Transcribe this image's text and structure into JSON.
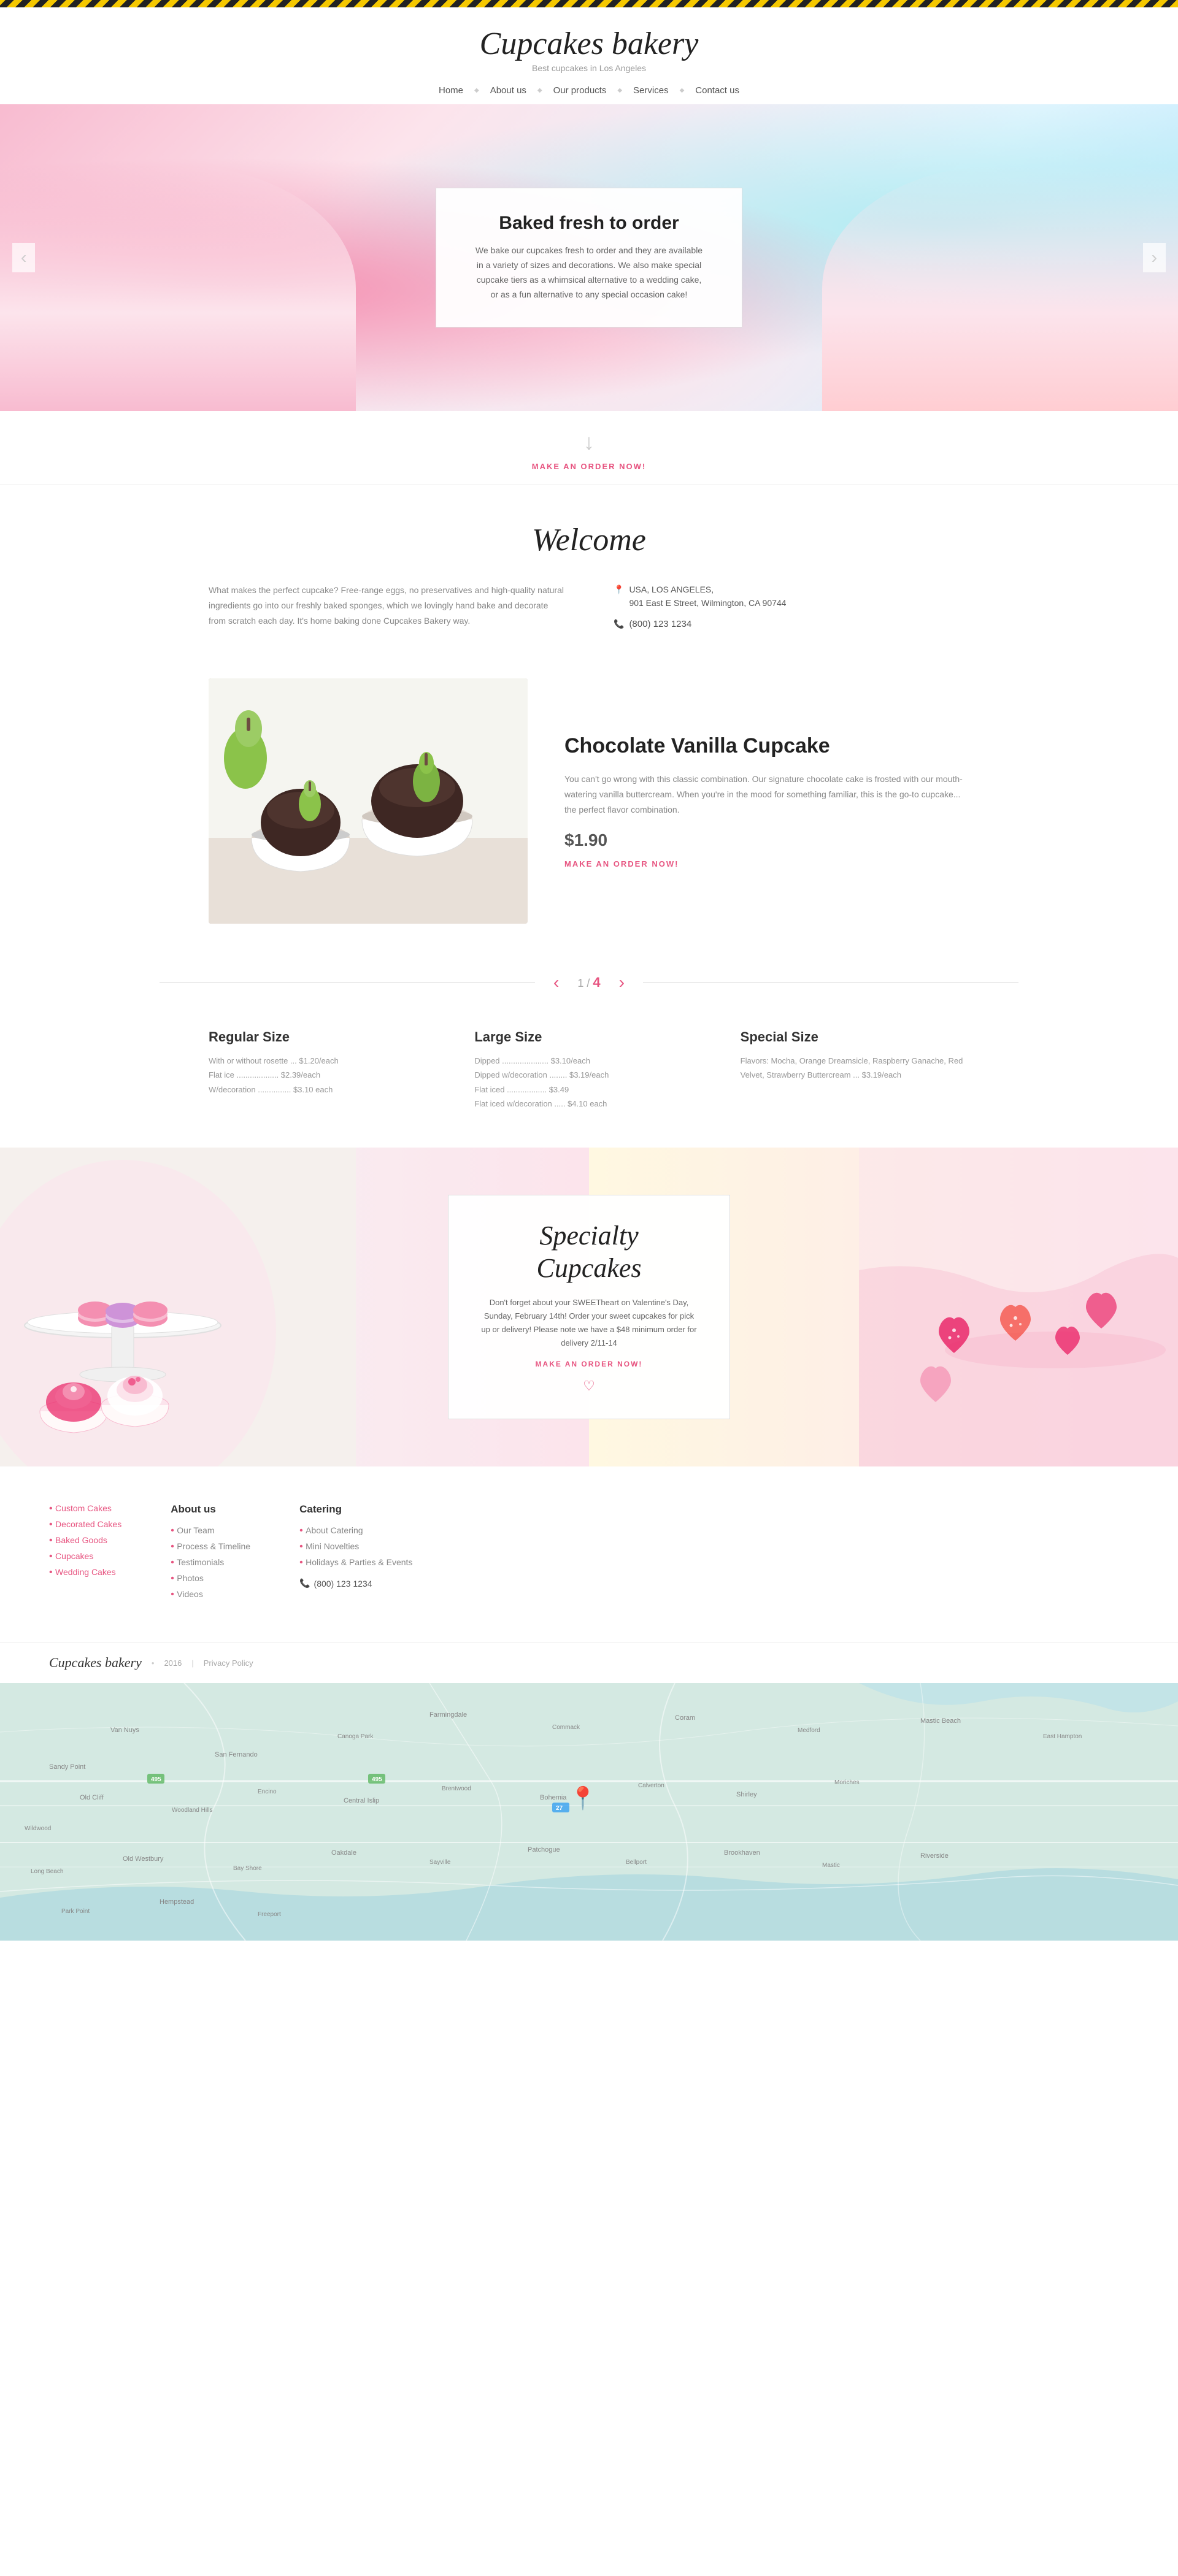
{
  "site": {
    "title": "Cupcakes bakery",
    "subtitle": "Best cupcakes in Los Angeles"
  },
  "nav": {
    "items": [
      {
        "label": "Home",
        "href": "#"
      },
      {
        "label": "About us",
        "href": "#"
      },
      {
        "label": "Our products",
        "href": "#"
      },
      {
        "label": "Services",
        "href": "#"
      },
      {
        "label": "Contact us",
        "href": "#"
      }
    ]
  },
  "hero": {
    "title": "Baked fresh to order",
    "description": "We bake our cupcakes fresh to order and they are available in a variety of sizes and decorations. We also make special cupcake tiers as a whimsical alternative to a wedding cake, or as a fun alternative to any special occasion cake!",
    "arrow_left": "‹",
    "arrow_right": "›"
  },
  "cta": {
    "arrow": "↓",
    "label": "MAKE AN ORDER NOW!"
  },
  "welcome": {
    "title": "Welcome",
    "text": "What makes the perfect cupcake? Free-range eggs, no preservatives and high-quality natural ingredients go into our freshly baked sponges, which we lovingly hand bake and decorate from scratch each day. It's home baking done Cupcakes Bakery way.",
    "address_line1": "USA, LOS ANGELES,",
    "address_line2": "901 East E Street, Wilmington, CA 90744",
    "phone": "(800) 123 1234"
  },
  "product": {
    "name": "Chocolate Vanilla Cupcake",
    "description": "You can't go wrong with this classic combination. Our signature chocolate cake is frosted with our mouth-watering vanilla buttercream. When you're in the mood for something familiar, this is the go-to cupcake... the perfect flavor combination.",
    "price": "$1.90",
    "order_label": "MAKE AN ORDER NOW!",
    "page_current": "1",
    "page_separator": "/",
    "page_total": "4"
  },
  "sizes": [
    {
      "title": "Regular Size",
      "details": "With or without rosette ... $1.20/each\nFlat ice ................... $2.39/each\nW/decoration ............... $3.10 each"
    },
    {
      "title": "Large Size",
      "details": "Dipped ..................... $3.10/each\nDipped w/decoration ........ $3.19/each\nFlat iced .................. $3.49\nFlat iced w/decoration ..... $4.10 each"
    },
    {
      "title": "Special Size",
      "details": "Flavors: Mocha, Orange Dreamsicle, Raspberry Ganache, Red Velvet, Strawberry Buttercream ... $3.19/each"
    }
  ],
  "specialty": {
    "title": "Specialty\nCupcakes",
    "description": "Don't forget about your SWEETheart on Valentine's Day, Sunday, February 14th! Order your sweet cupcakes for pick up or delivery! Please note we have a $48 minimum order for delivery 2/11-14",
    "order_label": "MAKE AN ORDER NOW!",
    "heart": "♡"
  },
  "footer": {
    "col1_title": "",
    "col1_links": [
      {
        "label": "Custom Cakes",
        "href": "#"
      },
      {
        "label": "Decorated Cakes",
        "href": "#"
      },
      {
        "label": "Baked Goods",
        "href": "#"
      },
      {
        "label": "Cupcakes",
        "href": "#"
      },
      {
        "label": "Wedding Cakes",
        "href": "#"
      }
    ],
    "col2_title": "About us",
    "col2_links": [
      {
        "label": "Our Team",
        "href": "#"
      },
      {
        "label": "Process & Timeline",
        "href": "#"
      },
      {
        "label": "Testimonials",
        "href": "#"
      },
      {
        "label": "Photos",
        "href": "#"
      },
      {
        "label": "Videos",
        "href": "#"
      }
    ],
    "col3_title": "Catering",
    "col3_links": [
      {
        "label": "About Catering",
        "href": "#"
      },
      {
        "label": "Mini Novelties",
        "href": "#"
      },
      {
        "label": "Holidays & Parties & Events",
        "href": "#"
      }
    ],
    "phone": "(800) 123 1234",
    "brand": "Cupcakes bakery",
    "year": "2016",
    "privacy": "Privacy Policy"
  }
}
